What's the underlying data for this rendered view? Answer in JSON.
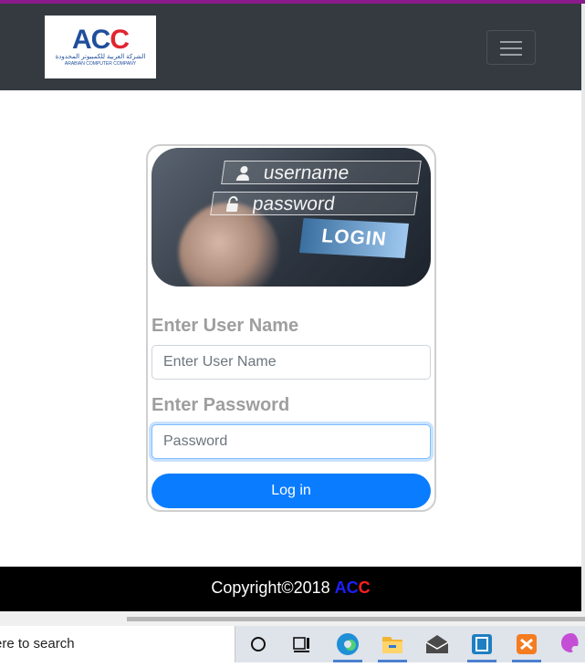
{
  "navbar": {
    "logo_text": "ACC",
    "logo_arabic": "الشركة العربية للكمبيوتر المحدودة",
    "logo_english": "ARABIAN COMPUTER COMPANY",
    "menu_icon": "hamburger-icon"
  },
  "hero": {
    "username_text": "username",
    "password_text": "password",
    "login_text": "LOGIN"
  },
  "form": {
    "username_label": "Enter User Name",
    "username_placeholder": "Enter User Name",
    "password_label": "Enter Password",
    "password_placeholder": "Password",
    "submit_label": "Log in"
  },
  "footer": {
    "copyright": "Copyright©2018 ",
    "brand_ac": "AC",
    "brand_c": "C"
  },
  "taskbar": {
    "search_text": "ere to search",
    "icons": [
      "cortana-icon",
      "task-view-icon",
      "edge-icon",
      "file-explorer-icon",
      "mail-icon",
      "app-icon",
      "xampp-icon",
      "paint-icon"
    ]
  },
  "colors": {
    "navbar": "#343a40",
    "accent": "#8b1a8b",
    "button": "#0a7cff",
    "footer": "#000000"
  }
}
